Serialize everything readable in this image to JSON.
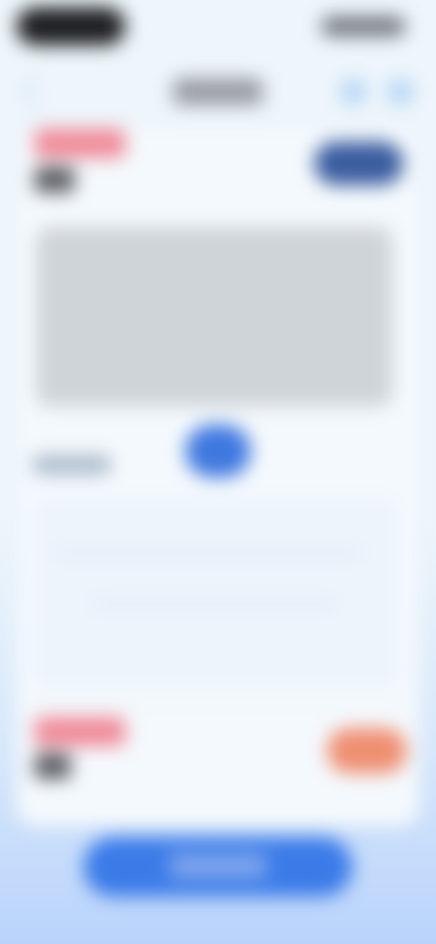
{
  "screen": {
    "title": "",
    "note": ""
  },
  "status_bar": {
    "time": "",
    "indicators": ""
  },
  "header": {
    "title": "",
    "icons": [
      "",
      ""
    ]
  },
  "section_1": {
    "label": "",
    "subtext": "",
    "top_action_label": ""
  },
  "middle": {
    "toggle_label": "",
    "section_label": ""
  },
  "section_2": {
    "label": "",
    "subtext": "",
    "action_label": ""
  },
  "bottom": {
    "primary_action_label": ""
  },
  "colors": {
    "primary": "#3a7be8",
    "accent_pink": "#f08a98",
    "accent_orange": "#ef8f72",
    "navy_button": "#3b5d9f",
    "background": "#eef6fb"
  },
  "icons": {
    "status_left": "pill-indicator",
    "header_icon_1": "circle-icon",
    "header_icon_2": "circle-icon"
  }
}
